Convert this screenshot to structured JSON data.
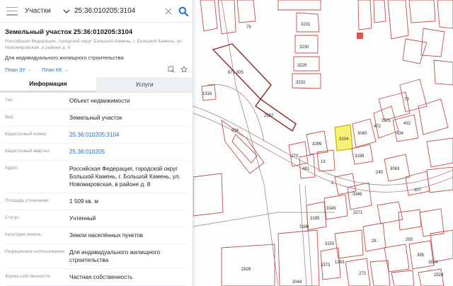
{
  "search": {
    "type": "Участки",
    "value": "25:36:010205:3104"
  },
  "header": {
    "title": "Земельный участок 25:36:010205:3104",
    "address": "Российская Федерация, городской округ Большой Камень, г. Большой Камень, ул. Новомировская, в районе д. 8",
    "purpose": "Для индивидуального жилищного строительства",
    "link_zu": "План ЗУ",
    "link_kk": "План КК",
    "link_arrow": "→"
  },
  "tabs": {
    "info": "Информация",
    "services": "Услуги"
  },
  "rows": [
    {
      "label": "Тип:",
      "value": "Объект недвижимости",
      "link": false
    },
    {
      "label": "Вид:",
      "value": "Земельный участок",
      "link": false
    },
    {
      "label": "Кадастровый номер:",
      "value": "25:36:010205:3104",
      "link": true
    },
    {
      "label": "Кадастровый квартал:",
      "value": "25:36:010205",
      "link": true
    },
    {
      "label": "Адрес:",
      "value": "Российская Федерация, городской округ Большой Камень, г. Большой Камень, ул. Новомировская, в районе д. 8",
      "link": false
    },
    {
      "label": "Площадь уточненная:",
      "value": "1 509 кв. м",
      "link": false
    },
    {
      "label": "Статус:",
      "value": "Учтенный",
      "link": false
    },
    {
      "label": "Категория земель:",
      "value": "Земли населённых пунктов",
      "link": false
    },
    {
      "label": "Разрешенное использование:",
      "value": "Для индивидуального жилищного строительства",
      "link": false
    },
    {
      "label": "Форма собственности:",
      "value": "Частная собственность",
      "link": false
    }
  ],
  "map": {
    "plot_numbers": [
      "75",
      "3231",
      "3230",
      "3229",
      "3232",
      "871 305",
      "2537",
      "934",
      "3299",
      "3040",
      "3104",
      "3198",
      "2501",
      "432",
      "73",
      "434",
      "472",
      "270",
      "13",
      "461",
      "240",
      "3063",
      "2",
      "307",
      "3346",
      "3349",
      "2271",
      "3185",
      "3186",
      "3155",
      "28",
      "395",
      "293",
      "3524",
      "1263",
      "272",
      "2826",
      "3044",
      "1316",
      "3373",
      "2524"
    ],
    "colors": {
      "boundary": "#c0504d",
      "selected_fill": "#f6f076"
    }
  },
  "colors": {
    "link": "#1b6fd1",
    "muted": "#8a939c"
  }
}
